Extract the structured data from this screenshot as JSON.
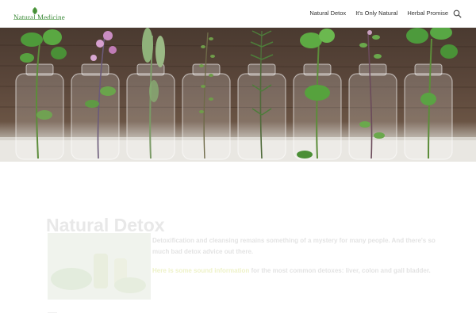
{
  "header": {
    "logo_text": "Natural Medicine",
    "nav": [
      {
        "label": "Natural Detox"
      },
      {
        "label": "It's Only Natural"
      },
      {
        "label": "Herbal Promise"
      }
    ],
    "search_icon": "search-icon"
  },
  "hero": {
    "image_subject": "herbs in glass bottles"
  },
  "article": {
    "title": "Natural Detox",
    "paragraph1": "Detoxification and cleansing remains something of a mystery for many people. And there's so much bad detox advice out there.",
    "paragraph2_link": "Here is some sound information",
    "paragraph2_rest": " for the most common detoxes: liver, colon and gall bladder."
  },
  "colors": {
    "brand_green": "#3d8a3a",
    "nav_text": "#333333",
    "faded_text": "#e3e3e3"
  }
}
